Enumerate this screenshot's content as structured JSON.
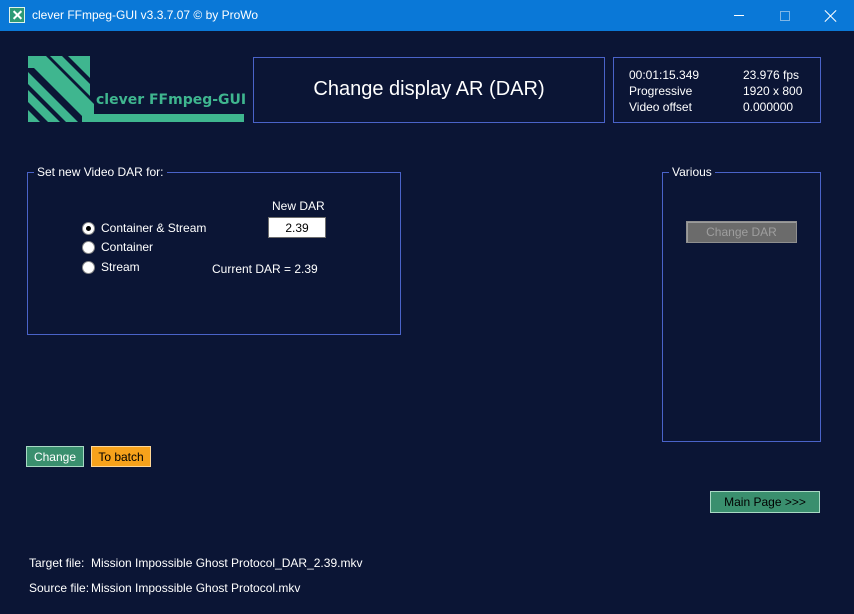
{
  "window": {
    "title": "clever FFmpeg-GUI v3.3.7.07   © by ProWo"
  },
  "logo": {
    "text": "clever FFmpeg-GUI"
  },
  "header": {
    "heading": "Change display AR (DAR)"
  },
  "info": {
    "duration": "00:01:15.349",
    "fps": "23.976 fps",
    "scan": "Progressive",
    "resolution": "1920 x 800",
    "video_offset_label": "Video offset",
    "video_offset_value": "0.000000"
  },
  "dar_group": {
    "legend": "Set new Video DAR for:",
    "options": [
      {
        "label": "Container & Stream",
        "checked": true
      },
      {
        "label": "Container",
        "checked": false
      },
      {
        "label": "Stream",
        "checked": false
      }
    ],
    "new_dar_label": "New DAR",
    "new_dar_value": "2.39",
    "current_dar": "Current DAR = 2.39"
  },
  "various_group": {
    "legend": "Various",
    "change_dar_button": "Change DAR"
  },
  "actions": {
    "change_label": "Change",
    "batch_label": "To batch",
    "main_page_label": "Main Page >>>"
  },
  "files": {
    "target_label": "Target file:",
    "target_value": "Mission Impossible Ghost Protocol_DAR_2.39.mkv",
    "source_label": "Source file:",
    "source_value": "Mission Impossible Ghost Protocol.mkv"
  },
  "colors": {
    "background": "#0b1535",
    "titlebar": "#0a78d7",
    "accent_green": "#3a8f6e",
    "accent_orange": "#f7a21b",
    "panel_border": "#4a63c9"
  }
}
